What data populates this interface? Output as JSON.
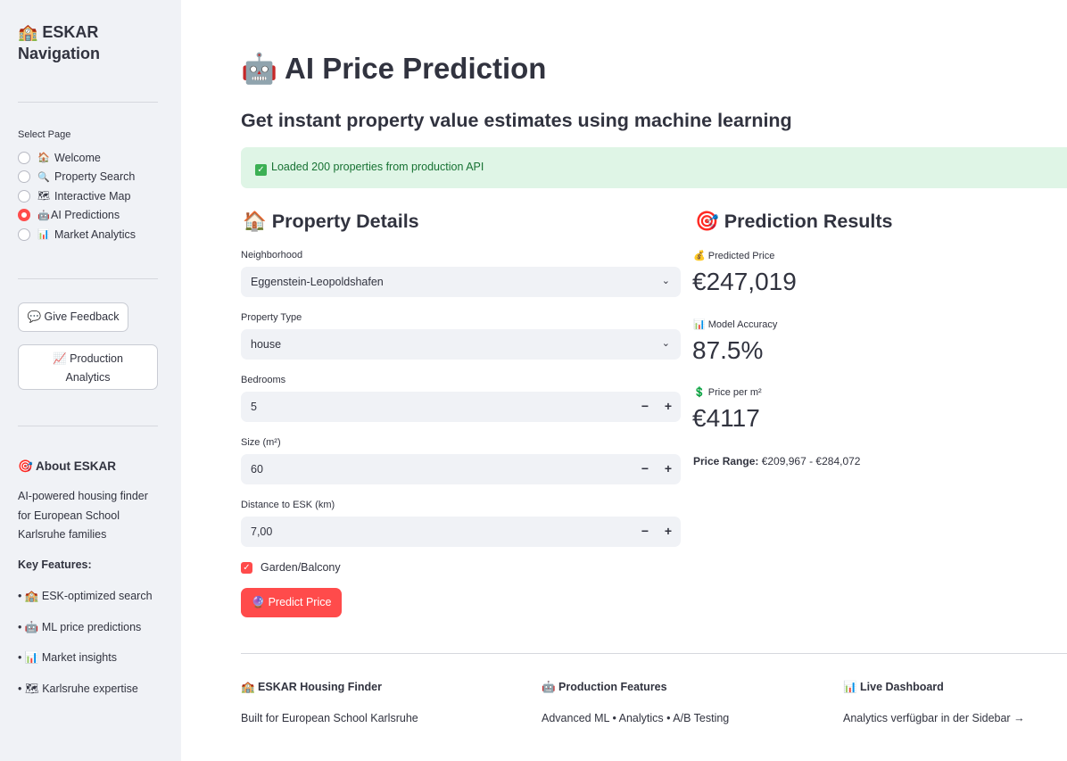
{
  "sidebar": {
    "title": "🏫 ESKAR Navigation",
    "select_label": "Select Page",
    "pages": [
      {
        "icon": "🏠",
        "label": "Welcome",
        "selected": false
      },
      {
        "icon": "🔍",
        "label": "Property Search",
        "selected": false
      },
      {
        "icon": "🗺",
        "label": "Interactive Map",
        "selected": false
      },
      {
        "icon": "🤖",
        "label": "AI Predictions",
        "selected": true
      },
      {
        "icon": "📊",
        "label": "Market Analytics",
        "selected": false
      }
    ],
    "feedback_button": "💬 Give Feedback",
    "analytics_button": "📈 Production Analytics",
    "about_title": "🎯 About ESKAR",
    "about_text": "AI-powered housing finder for European School Karlsruhe families",
    "key_features_title": "Key Features:",
    "features": [
      "• 🏫 ESK-optimized search",
      "• 🤖 ML price predictions",
      "• 📊 Market insights",
      "• 🗺 Karlsruhe expertise"
    ]
  },
  "main": {
    "title": "🤖 AI Price Prediction",
    "subtitle": "Get instant property value estimates using machine learning",
    "success_message": "Loaded 200 properties from production API",
    "details_title": "🏠 Property Details",
    "results_title": "🎯 Prediction Results",
    "fields": {
      "neighborhood_label": "Neighborhood",
      "neighborhood_value": "Eggenstein-Leopoldshafen",
      "type_label": "Property Type",
      "type_value": "house",
      "bedrooms_label": "Bedrooms",
      "bedrooms_value": "5",
      "size_label": "Size (m²)",
      "size_value": "60",
      "distance_label": "Distance to ESK (km)",
      "distance_value": "7,00"
    },
    "garden_label": "Garden/Balcony",
    "garden_checked": true,
    "predict_button": "🔮 Predict Price",
    "results": {
      "price_label": "💰 Predicted Price",
      "price_value": "€247,019",
      "accuracy_label": "📊 Model Accuracy",
      "accuracy_value": "87.5%",
      "ppm_label": "💲 Price per m²",
      "ppm_value": "€4117",
      "range_label": "Price Range:",
      "range_value": "€209,967 - €284,072"
    }
  },
  "footer": {
    "col1_title": "🏫 ESKAR Housing Finder",
    "col1_text": "Built for European School Karlsruhe",
    "col2_title": "🤖 Production Features",
    "col2_text": "Advanced ML • Analytics • A/B Testing",
    "col3_title": "📊 Live Dashboard",
    "col3_text": "Analytics verfügbar in der Sidebar →"
  },
  "colors": {
    "accent": "#ff4b4b",
    "sidebar_bg": "#f0f2f6",
    "success_bg": "#dff5e6",
    "success_text": "#177233"
  }
}
